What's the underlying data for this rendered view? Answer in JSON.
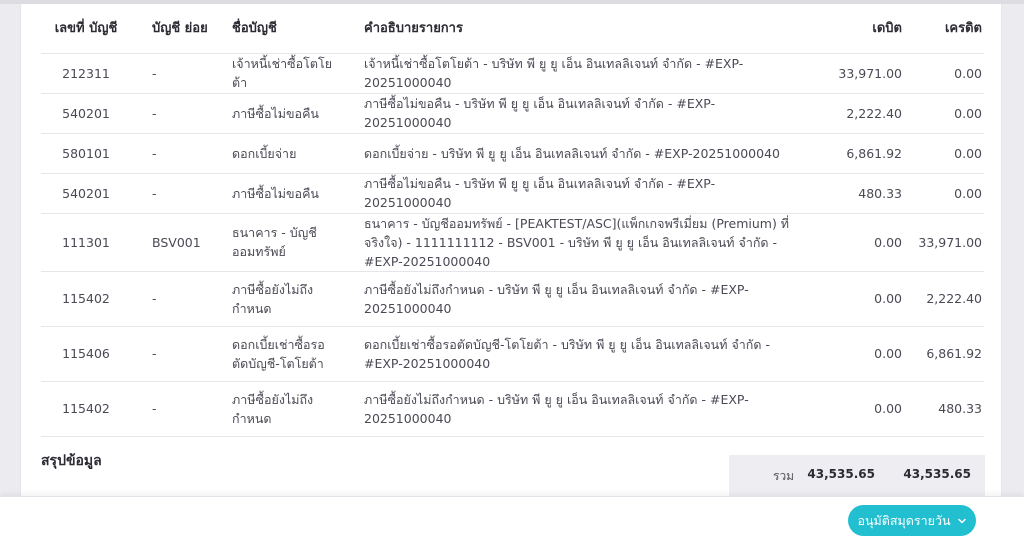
{
  "table": {
    "headers": {
      "account_no": "เลขที่ บัญชี",
      "sub_account": "บัญชี ย่อย",
      "account_name": "ชื่อบัญชี",
      "description": "คำอธิบายรายการ",
      "debit": "เดบิต",
      "credit": "เครดิต"
    },
    "rows": [
      {
        "account_no": "212311",
        "sub_account": "-",
        "account_name": "เจ้าหนี้เช่าซื้อโตโยต้า",
        "description": "เจ้าหนี้เช่าซื้อโตโยต้า - บริษัท พี ยู ยู เอ็น อินเทลลิเจนท์ จำกัด - #EXP-20251000040",
        "debit": "33,971.00",
        "credit": "0.00"
      },
      {
        "account_no": "540201",
        "sub_account": "-",
        "account_name": "ภาษีซื้อไม่ขอคืน",
        "description": "ภาษีซื้อไม่ขอคืน - บริษัท พี ยู ยู เอ็น อินเทลลิเจนท์ จำกัด - #EXP-20251000040",
        "debit": "2,222.40",
        "credit": "0.00"
      },
      {
        "account_no": "580101",
        "sub_account": "-",
        "account_name": "ดอกเบี้ยจ่าย",
        "description": "ดอกเบี้ยจ่าย - บริษัท พี ยู ยู เอ็น อินเทลลิเจนท์ จำกัด - #EXP-20251000040",
        "debit": "6,861.92",
        "credit": "0.00"
      },
      {
        "account_no": "540201",
        "sub_account": "-",
        "account_name": "ภาษีซื้อไม่ขอคืน",
        "description": "ภาษีซื้อไม่ขอคืน - บริษัท พี ยู ยู เอ็น อินเทลลิเจนท์ จำกัด - #EXP-20251000040",
        "debit": "480.33",
        "credit": "0.00"
      },
      {
        "account_no": "111301",
        "sub_account": "BSV001",
        "account_name": "ธนาคาร - บัญชีออมทรัพย์",
        "description": "ธนาคาร - บัญชีออมทรัพย์ - [PEAKTEST/ASC](แพ็กเกจพรีเมี่ยม (Premium) ที่จริงใจ) - 1111111112 - BSV001 - บริษัท พี ยู ยู เอ็น อินเทลลิเจนท์ จำกัด - #EXP-20251000040",
        "debit": "0.00",
        "credit": "33,971.00"
      },
      {
        "account_no": "115402",
        "sub_account": "-",
        "account_name": "ภาษีซื้อยังไม่ถึงกำหนด",
        "description": "ภาษีซื้อยังไม่ถึงกำหนด - บริษัท พี ยู ยู เอ็น อินเทลลิเจนท์ จำกัด - #EXP-20251000040",
        "debit": "0.00",
        "credit": "2,222.40"
      },
      {
        "account_no": "115406",
        "sub_account": "-",
        "account_name": "ดอกเบี้ยเช่าซื้อรอตัดบัญชี-โตโยต้า",
        "description": "ดอกเบี้ยเช่าซื้อรอตัดบัญชี-โตโยต้า - บริษัท พี ยู ยู เอ็น อินเทลลิเจนท์ จำกัด - #EXP-20251000040",
        "debit": "0.00",
        "credit": "6,861.92"
      },
      {
        "account_no": "115402",
        "sub_account": "-",
        "account_name": "ภาษีซื้อยังไม่ถึงกำหนด",
        "description": "ภาษีซื้อยังไม่ถึงกำหนด - บริษัท พี ยู ยู เอ็น อินเทลลิเจนท์ จำกัด - #EXP-20251000040",
        "debit": "0.00",
        "credit": "480.33"
      }
    ]
  },
  "summary": {
    "title": "สรุปข้อมูล",
    "total_label": "รวม",
    "total_debit": "43,535.65",
    "total_credit": "43,535.65"
  },
  "footer": {
    "approve_button_label": "อนุมัติสมุดรายวัน",
    "approve_button_icon": "chevron-down-icon"
  },
  "colors": {
    "accent": "#22bfd0",
    "page_background": "#ececf0",
    "summary_background": "#eeeef2"
  }
}
